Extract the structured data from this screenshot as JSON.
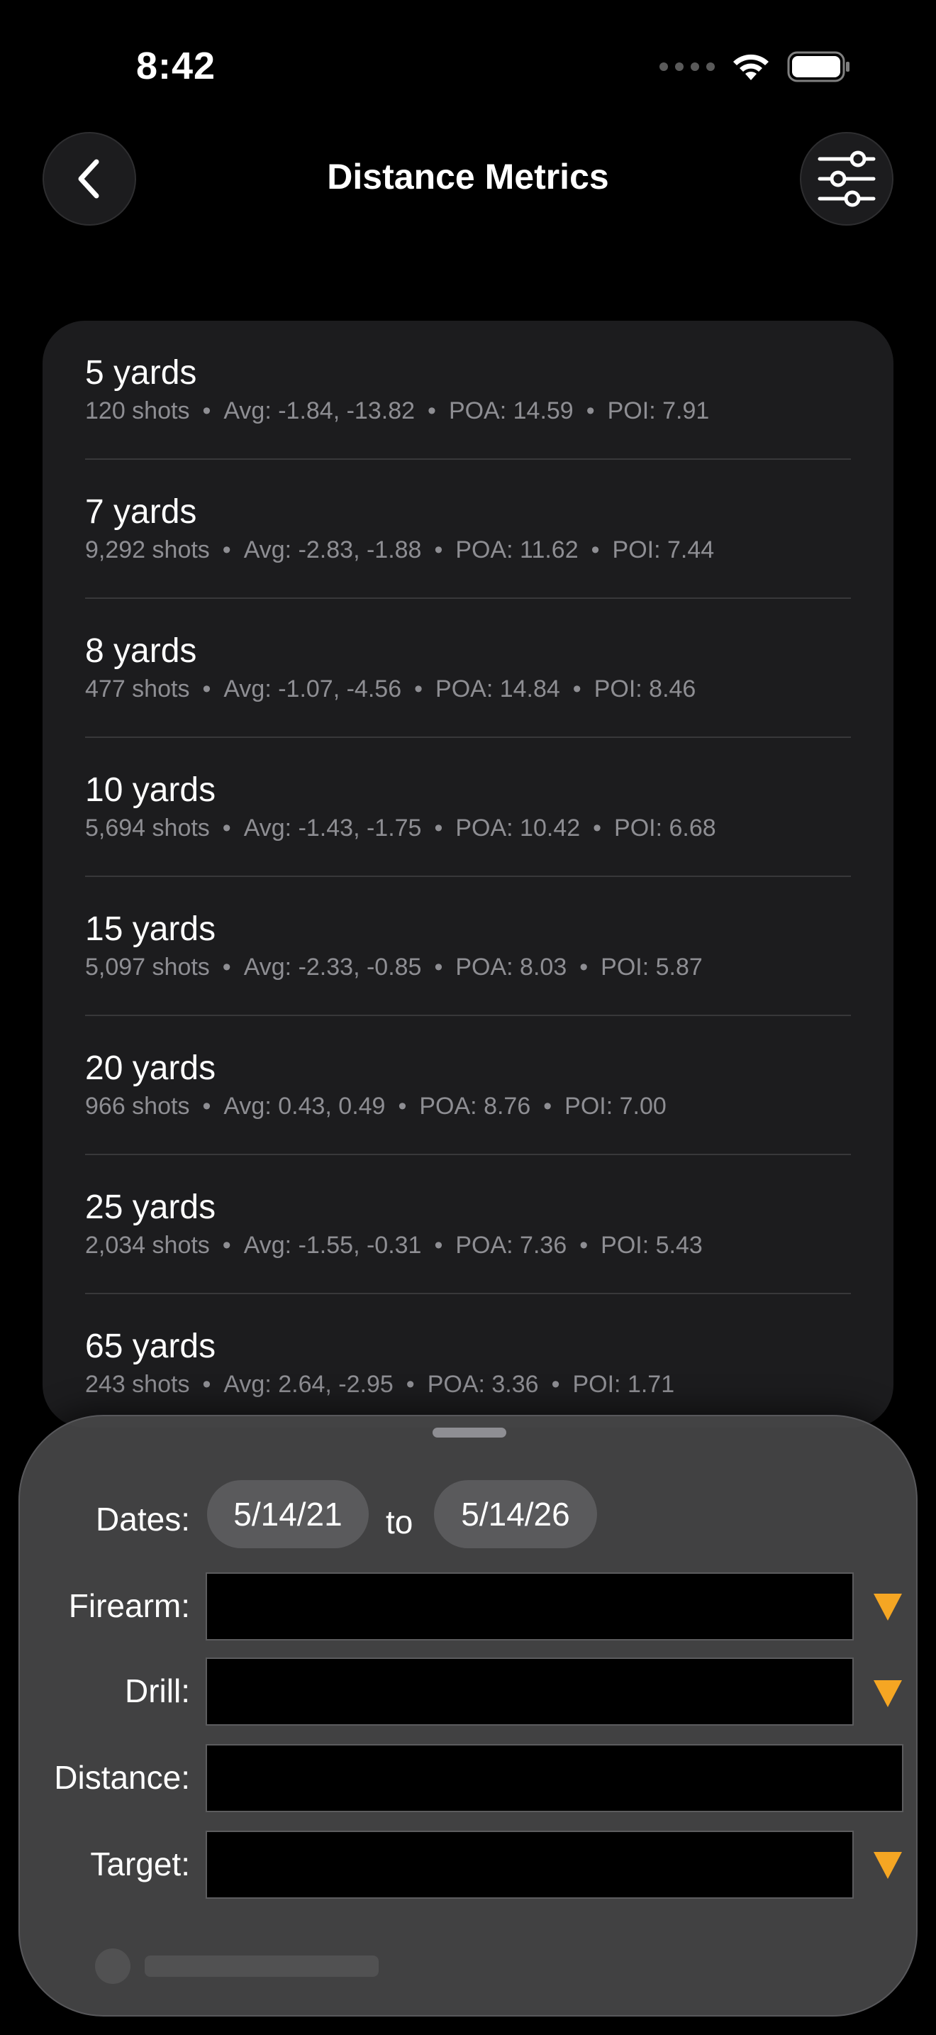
{
  "status": {
    "time": "8:42"
  },
  "nav": {
    "title": "Distance Metrics"
  },
  "icons": {
    "back": "chevron-left-icon",
    "filter": "sliders-icon"
  },
  "metrics": [
    {
      "distance": "5 yards",
      "shots": "120 shots",
      "avg": "Avg: -1.84, -13.82",
      "poa": "POA: 14.59",
      "poi": "POI: 7.91"
    },
    {
      "distance": "7 yards",
      "shots": "9,292 shots",
      "avg": "Avg: -2.83, -1.88",
      "poa": "POA: 11.62",
      "poi": "POI: 7.44"
    },
    {
      "distance": "8 yards",
      "shots": "477 shots",
      "avg": "Avg: -1.07, -4.56",
      "poa": "POA: 14.84",
      "poi": "POI: 8.46"
    },
    {
      "distance": "10 yards",
      "shots": "5,694 shots",
      "avg": "Avg: -1.43, -1.75",
      "poa": "POA: 10.42",
      "poi": "POI: 6.68"
    },
    {
      "distance": "15 yards",
      "shots": "5,097 shots",
      "avg": "Avg: -2.33, -0.85",
      "poa": "POA: 8.03",
      "poi": "POI: 5.87"
    },
    {
      "distance": "20 yards",
      "shots": "966 shots",
      "avg": "Avg: 0.43, 0.49",
      "poa": "POA: 8.76",
      "poi": "POI: 7.00"
    },
    {
      "distance": "25 yards",
      "shots": "2,034 shots",
      "avg": "Avg: -1.55, -0.31",
      "poa": "POA: 7.36",
      "poi": "POI: 5.43"
    },
    {
      "distance": "65 yards",
      "shots": "243 shots",
      "avg": "Avg: 2.64, -2.95",
      "poa": "POA: 3.36",
      "poi": "POI: 1.71"
    }
  ],
  "separator": "•",
  "filters": {
    "dates_label": "Dates:",
    "start_date": "5/14/21",
    "to": "to",
    "end_date": "5/14/26",
    "firearm_label": "Firearm:",
    "firearm_value": "",
    "drill_label": "Drill:",
    "drill_value": "",
    "distance_label": "Distance:",
    "distance_value": "",
    "target_label": "Target:",
    "target_value": ""
  },
  "colors": {
    "accent": "#f5a623",
    "card": "#1c1c1e",
    "secondary_text": "#8e8e93"
  }
}
